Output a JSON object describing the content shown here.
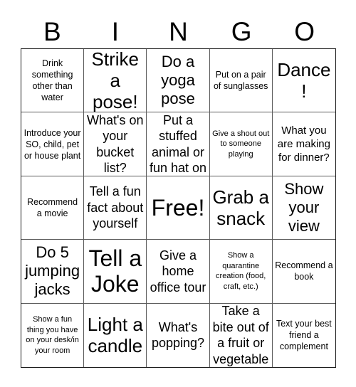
{
  "header": {
    "letters": [
      "B",
      "I",
      "N",
      "G",
      "O"
    ]
  },
  "grid": {
    "rows": 5,
    "columns": 5,
    "cells": [
      {
        "text": "Drink something other than water",
        "size": "t-sm"
      },
      {
        "text": "Strike a pose!",
        "size": "t-xxl"
      },
      {
        "text": "Do a yoga pose",
        "size": "t-xl"
      },
      {
        "text": "Put on a pair of sunglasses",
        "size": "t-sm"
      },
      {
        "text": "Dance!",
        "size": "t-xxl"
      },
      {
        "text": "Introduce your SO, child, pet or house plant",
        "size": "t-sm"
      },
      {
        "text": "What's on your bucket list?",
        "size": "t-lg"
      },
      {
        "text": "Put a stuffed animal or fun hat on",
        "size": "t-lg"
      },
      {
        "text": "Give a shout out to someone playing",
        "size": "t-xs"
      },
      {
        "text": "What you are making for dinner?",
        "size": "t-md"
      },
      {
        "text": "Recommend a movie",
        "size": "t-sm"
      },
      {
        "text": "Tell a fun fact about yourself",
        "size": "t-lg"
      },
      {
        "text": "Free!",
        "size": "t-huge"
      },
      {
        "text": "Grab a snack",
        "size": "t-xxl"
      },
      {
        "text": "Show your view",
        "size": "t-xl"
      },
      {
        "text": "Do 5 jumping jacks",
        "size": "t-xl"
      },
      {
        "text": "Tell a Joke",
        "size": "t-huge"
      },
      {
        "text": "Give a home office tour",
        "size": "t-lg"
      },
      {
        "text": "Show a quarantine creation (food, craft, etc.)",
        "size": "t-xs"
      },
      {
        "text": "Recommend a book",
        "size": "t-sm"
      },
      {
        "text": "Show a fun thing you have on your desk/in your room",
        "size": "t-xs"
      },
      {
        "text": "Light a candle",
        "size": "t-xxl"
      },
      {
        "text": "What's popping?",
        "size": "t-lg"
      },
      {
        "text": "Take a bite out of a fruit or vegetable",
        "size": "t-lg"
      },
      {
        "text": "Text your best friend a complement",
        "size": "t-sm"
      }
    ]
  },
  "colors": {
    "background": "#ffffff",
    "text": "#000000",
    "grid_line": "#5a5a5a",
    "outer_border": "#1a1a1a"
  }
}
